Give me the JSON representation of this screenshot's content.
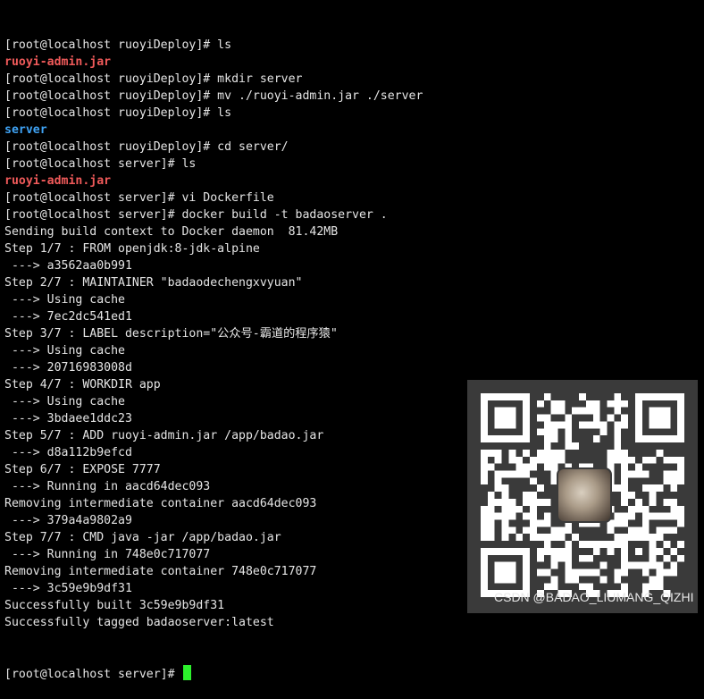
{
  "terminal": {
    "lines": [
      {
        "text": "[root@localhost ruoyiDeploy]# ls",
        "style": "normal"
      },
      {
        "text": "ruoyi-admin.jar",
        "style": "red"
      },
      {
        "text": "[root@localhost ruoyiDeploy]# mkdir server",
        "style": "normal"
      },
      {
        "text": "[root@localhost ruoyiDeploy]# mv ./ruoyi-admin.jar ./server",
        "style": "normal"
      },
      {
        "text": "[root@localhost ruoyiDeploy]# ls",
        "style": "normal"
      },
      {
        "text": "server",
        "style": "blue"
      },
      {
        "text": "[root@localhost ruoyiDeploy]# cd server/",
        "style": "normal"
      },
      {
        "text": "[root@localhost server]# ls",
        "style": "normal"
      },
      {
        "text": "ruoyi-admin.jar",
        "style": "red"
      },
      {
        "text": "[root@localhost server]# vi Dockerfile",
        "style": "normal"
      },
      {
        "text": "[root@localhost server]# docker build -t badaoserver .",
        "style": "normal"
      },
      {
        "text": "Sending build context to Docker daemon  81.42MB",
        "style": "normal"
      },
      {
        "text": "Step 1/7 : FROM openjdk:8-jdk-alpine",
        "style": "normal"
      },
      {
        "text": " ---> a3562aa0b991",
        "style": "normal"
      },
      {
        "text": "Step 2/7 : MAINTAINER \"badaodechengxvyuan\"",
        "style": "normal"
      },
      {
        "text": " ---> Using cache",
        "style": "normal"
      },
      {
        "text": " ---> 7ec2dc541ed1",
        "style": "normal"
      },
      {
        "text": "Step 3/7 : LABEL description=\"公众号-霸道的程序猿\"",
        "style": "normal"
      },
      {
        "text": " ---> Using cache",
        "style": "normal"
      },
      {
        "text": " ---> 20716983008d",
        "style": "normal"
      },
      {
        "text": "Step 4/7 : WORKDIR app",
        "style": "normal"
      },
      {
        "text": " ---> Using cache",
        "style": "normal"
      },
      {
        "text": " ---> 3bdaee1ddc23",
        "style": "normal"
      },
      {
        "text": "Step 5/7 : ADD ruoyi-admin.jar /app/badao.jar",
        "style": "normal"
      },
      {
        "text": " ---> d8a112b9efcd",
        "style": "normal"
      },
      {
        "text": "Step 6/7 : EXPOSE 7777",
        "style": "normal"
      },
      {
        "text": " ---> Running in aacd64dec093",
        "style": "normal"
      },
      {
        "text": "Removing intermediate container aacd64dec093",
        "style": "normal"
      },
      {
        "text": " ---> 379a4a9802a9",
        "style": "normal"
      },
      {
        "text": "Step 7/7 : CMD java -jar /app/badao.jar",
        "style": "normal"
      },
      {
        "text": " ---> Running in 748e0c717077",
        "style": "normal"
      },
      {
        "text": "Removing intermediate container 748e0c717077",
        "style": "normal"
      },
      {
        "text": " ---> 3c59e9b9df31",
        "style": "normal"
      },
      {
        "text": "Successfully built 3c59e9b9df31",
        "style": "normal"
      },
      {
        "text": "Successfully tagged badaoserver:latest",
        "style": "normal"
      }
    ],
    "prompt": "[root@localhost server]# ",
    "cursor_color": "#2cf02c",
    "text_color": "#e5e5e5",
    "file_color": "#f05a5a",
    "dir_color": "#3fa3f5",
    "background": "#000000"
  },
  "overlay": {
    "qr_icon": "qr-code-icon",
    "photo_icon": "pug-avatar-icon",
    "watermark": "CSDN @BADAO_LIUMANG_QIZHI"
  }
}
